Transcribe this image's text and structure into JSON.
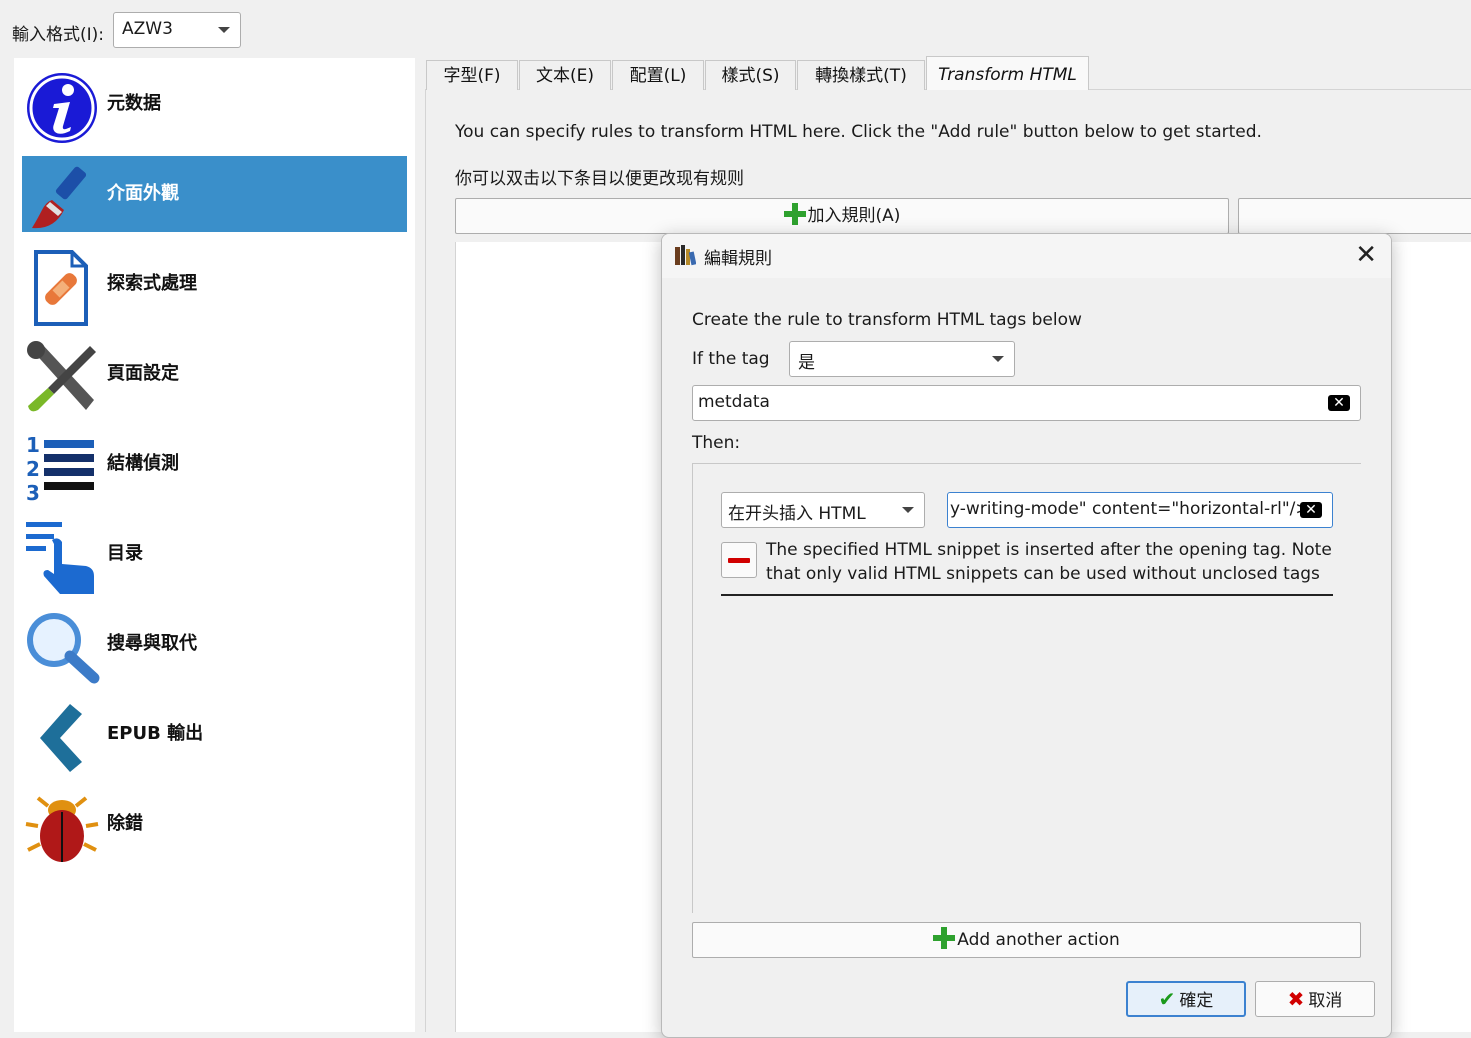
{
  "input_format": {
    "label": "輸入格式(I):",
    "value": "AZW3"
  },
  "sidebar": {
    "items": [
      {
        "label": "元数据",
        "icon": "info-icon"
      },
      {
        "label": "介面外觀",
        "icon": "paintbrush-icon"
      },
      {
        "label": "探索式處理",
        "icon": "bandaid-document-icon"
      },
      {
        "label": "頁面設定",
        "icon": "tools-icon"
      },
      {
        "label": "結構偵測",
        "icon": "numbered-list-icon"
      },
      {
        "label": "目录",
        "icon": "toc-pointer-icon"
      },
      {
        "label": "搜尋與取代",
        "icon": "search-icon"
      },
      {
        "label": "EPUB 輸出",
        "icon": "chevron-left-icon"
      },
      {
        "label": "除錯",
        "icon": "bug-icon"
      }
    ],
    "active_index": 1
  },
  "tabs": [
    "字型(F)",
    "文本(E)",
    "配置(L)",
    "樣式(S)",
    "轉換樣式(T)",
    "Transform HTML"
  ],
  "active_tab": "Transform HTML",
  "panel": {
    "intro": "You can specify rules to transform HTML here. Click the \"Add rule\" button below to get started.",
    "hint": "你可以双击以下条目以便更改现有规则",
    "add_rule_label": "加入規則(A)"
  },
  "dialog": {
    "title": "編輯規則",
    "create_label": "Create the rule to transform HTML tags below",
    "if_tag_label": "If the tag",
    "tag_match_value": "是",
    "tag_value": "metdata",
    "then_label": "Then:",
    "action_value": "在开头插入 HTML",
    "action_html_value": "y-writing-mode\" content=\"horizontal-rl\"/>",
    "action_description": "The specified HTML snippet is inserted after the opening tag. Note that only valid HTML snippets can be used without unclosed tags",
    "add_action_label": "Add another action",
    "ok_label": "確定",
    "cancel_label": "取消"
  },
  "colors": {
    "active_sidebar": "#3a8fca",
    "focus_border": "#3c82d0",
    "plus_green": "#2ea12e",
    "remove_red": "#d10000"
  }
}
